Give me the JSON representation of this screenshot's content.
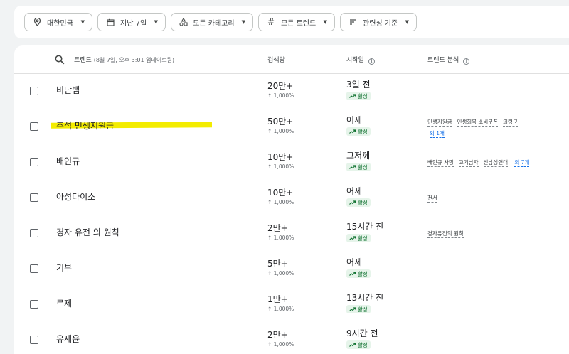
{
  "filters": [
    {
      "icon": "location-pin-icon",
      "label": "대한민국"
    },
    {
      "icon": "calendar-icon",
      "label": "지난 7일"
    },
    {
      "icon": "category-icon",
      "label": "모든 카테고리"
    },
    {
      "icon": "hash-icon",
      "label": "모든 트렌드"
    },
    {
      "icon": "sort-icon",
      "label": "관련성 기준"
    }
  ],
  "table": {
    "header": {
      "trend": "트렌드",
      "updated": "(8월 7일, 오후 3:01 업데이트됨)",
      "volume": "검색량",
      "started": "시작일",
      "breakdown": "트렌드 분석"
    },
    "rows": [
      {
        "name": "비단뱀",
        "volume": "20만+",
        "change": "↑ 1,000%",
        "started": "3일 전",
        "status": "활성",
        "breakdown": [],
        "more": ""
      },
      {
        "name": "추석 민생지원금",
        "volume": "50만+",
        "change": "↑ 1,000%",
        "started": "어제",
        "status": "활성",
        "breakdown": [
          "민생지원금",
          "민생회복 소비쿠폰",
          "의령군"
        ],
        "more": "외 1개"
      },
      {
        "name": "배인규",
        "volume": "10만+",
        "change": "↑ 1,000%",
        "started": "그저께",
        "status": "활성",
        "breakdown": [
          "배인규 사망",
          "고기남자",
          "신남성연대"
        ],
        "more": "외 7개"
      },
      {
        "name": "아성다이소",
        "volume": "10만+",
        "change": "↑ 1,000%",
        "started": "어제",
        "status": "활성",
        "breakdown": [
          "천서"
        ],
        "more": ""
      },
      {
        "name": "경자 유전 의 원칙",
        "volume": "2만+",
        "change": "↑ 1,000%",
        "started": "15시간 전",
        "status": "활성",
        "breakdown": [
          "경자유전의 원칙"
        ],
        "more": ""
      },
      {
        "name": "기부",
        "volume": "5만+",
        "change": "↑ 1,000%",
        "started": "어제",
        "status": "활성",
        "breakdown": [],
        "more": ""
      },
      {
        "name": "로제",
        "volume": "1만+",
        "change": "↑ 1,000%",
        "started": "13시간 전",
        "status": "활성",
        "breakdown": [],
        "more": ""
      },
      {
        "name": "유세윤",
        "volume": "2만+",
        "change": "↑ 1,000%",
        "started": "9시간 전",
        "status": "활성",
        "breakdown": [],
        "more": ""
      }
    ]
  },
  "colors": {
    "highlight": "#f3ec00",
    "active_bg": "#e6f4ea",
    "active_text": "#137333",
    "link": "#1a73e8"
  }
}
